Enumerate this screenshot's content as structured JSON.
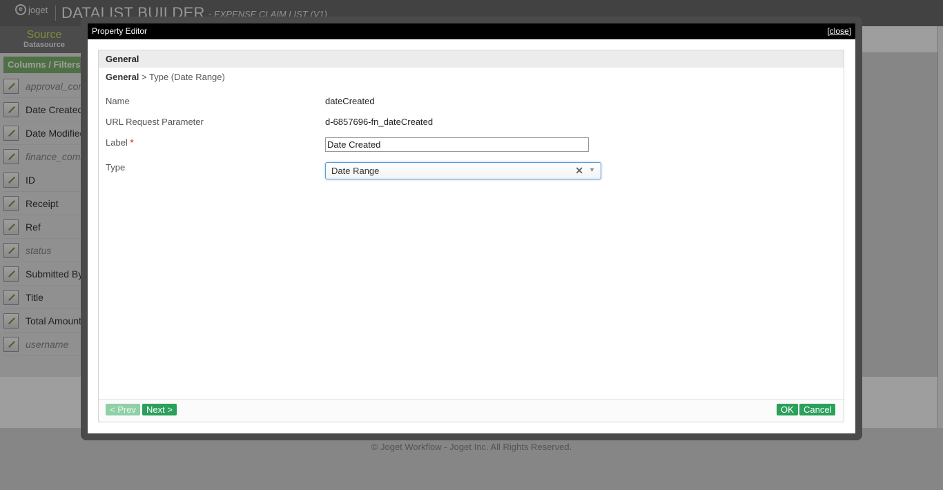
{
  "app": {
    "logo_text": "joget",
    "title": "DATALIST BUILDER",
    "subtitle": "- EXPENSE CLAIM LIST (V1)"
  },
  "tabs": {
    "source_label": "Source",
    "source_sublabel": "Datasource"
  },
  "sidebar": {
    "heading": "Columns / Filters",
    "items": [
      {
        "label": "approval_comments",
        "italic": true
      },
      {
        "label": "Date Created",
        "italic": false
      },
      {
        "label": "Date Modified",
        "italic": false
      },
      {
        "label": "finance_comments",
        "italic": true
      },
      {
        "label": "ID",
        "italic": false
      },
      {
        "label": "Receipt",
        "italic": false
      },
      {
        "label": "Ref",
        "italic": false
      },
      {
        "label": "status",
        "italic": true
      },
      {
        "label": "Submitted By",
        "italic": false
      },
      {
        "label": "Title",
        "italic": false
      },
      {
        "label": "Total Amount",
        "italic": false
      },
      {
        "label": "username",
        "italic": true
      }
    ]
  },
  "footer": {
    "text": "© Joget Workflow - Joget Inc. All Rights Reserved."
  },
  "dialog": {
    "title": "Property Editor",
    "close_label": "[close]",
    "panel_title": "General",
    "breadcrumb_root": "General",
    "breadcrumb_rest": " > Type (Date Range)",
    "fields": {
      "name_label": "Name",
      "name_value": "dateCreated",
      "url_param_label": "URL Request Parameter",
      "url_param_value": "d-6857696-fn_dateCreated",
      "label_label": "Label",
      "label_required": "*",
      "label_value": "Date Created",
      "type_label": "Type",
      "type_value": "Date Range",
      "type_clear_icon": "✕",
      "type_arrow_icon": "▼"
    },
    "buttons": {
      "prev": "< Prev",
      "next": "Next >",
      "ok": "OK",
      "cancel": "Cancel"
    }
  },
  "colors": {
    "accent_green": "#2aa05a",
    "sidebar_heading": "#7fb56e",
    "focus_blue": "#5b9dd9"
  }
}
